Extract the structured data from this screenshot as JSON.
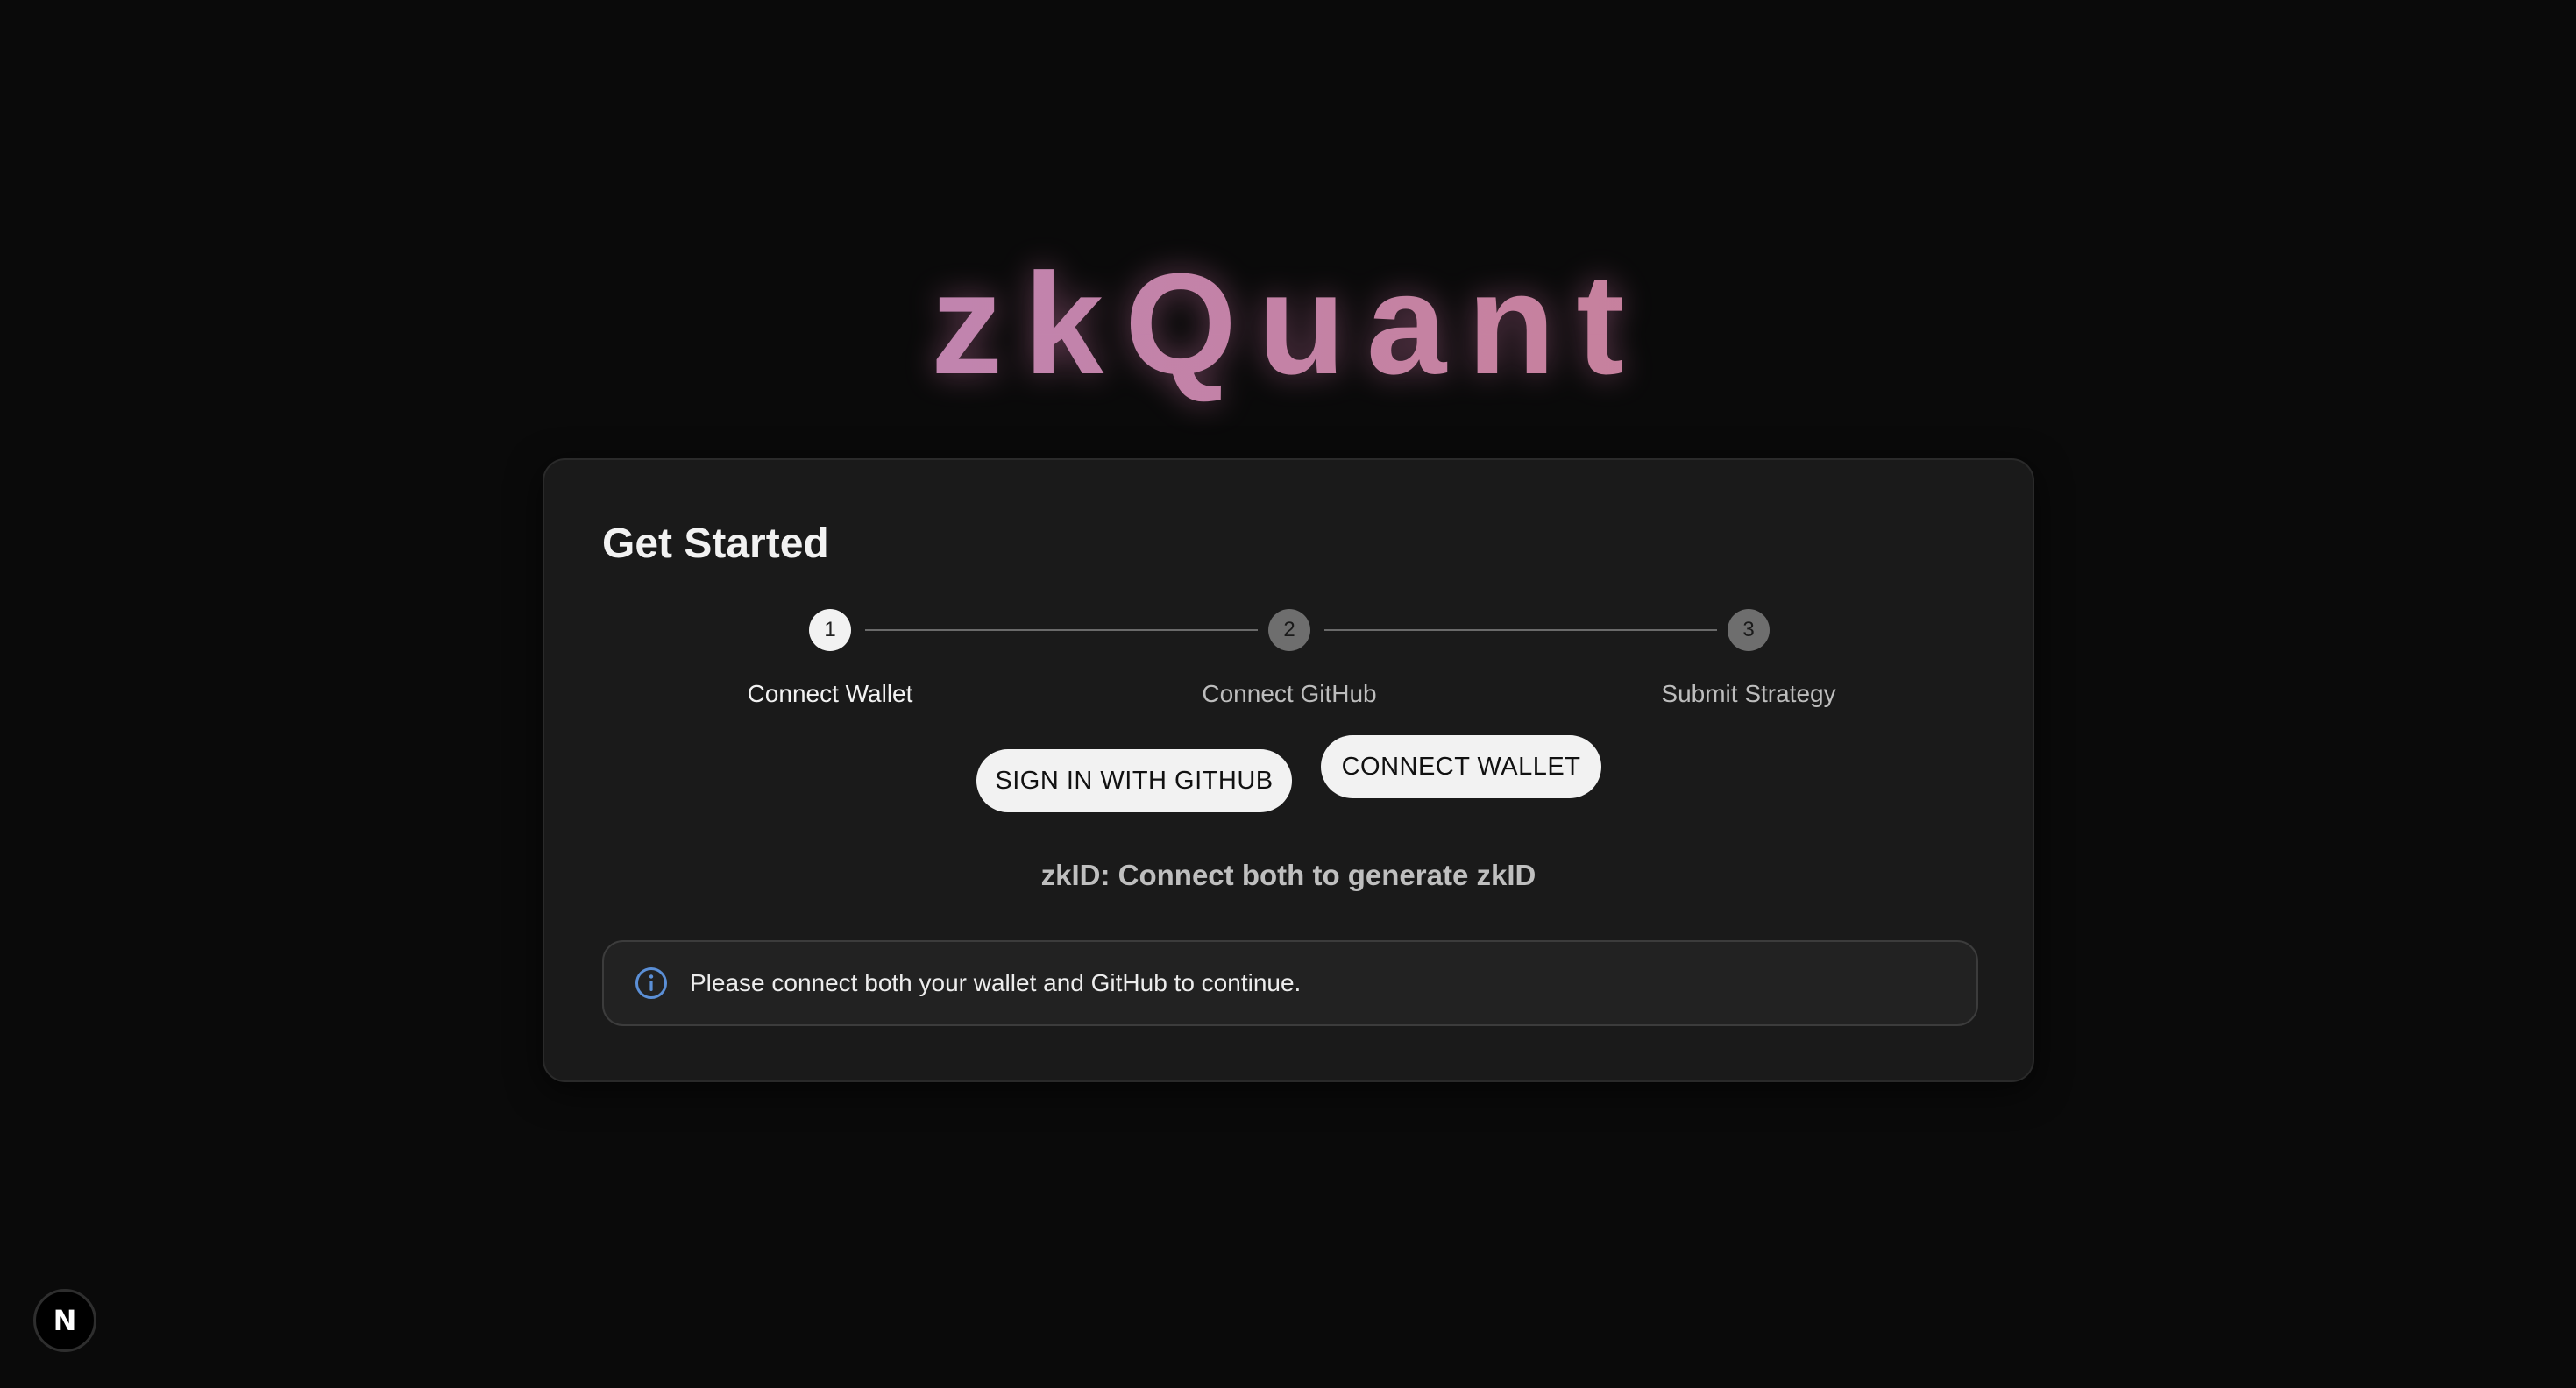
{
  "brand": {
    "title": "zkQuant"
  },
  "card": {
    "title": "Get Started",
    "steps": [
      {
        "number": "1",
        "label": "Connect Wallet",
        "state": "active"
      },
      {
        "number": "2",
        "label": "Connect GitHub",
        "state": "inactive"
      },
      {
        "number": "3",
        "label": "Submit Strategy",
        "state": "inactive"
      }
    ],
    "buttons": {
      "github_label": "SIGN IN WITH GITHUB",
      "wallet_label": "CONNECT WALLET"
    },
    "zkid_text": "zkID: Connect both to generate zkID",
    "alert": {
      "icon": "info-icon",
      "message": "Please connect both your wallet and GitHub to continue."
    }
  },
  "dev_badge": {
    "icon": "nextjs-icon",
    "glyph": "N"
  },
  "colors": {
    "background": "#0a0a0a",
    "card": "#1a1a1a",
    "brand_gradient_start": "#b988c6",
    "brand_gradient_end": "#cf7c8a",
    "info_accent": "#5b8fd6"
  }
}
